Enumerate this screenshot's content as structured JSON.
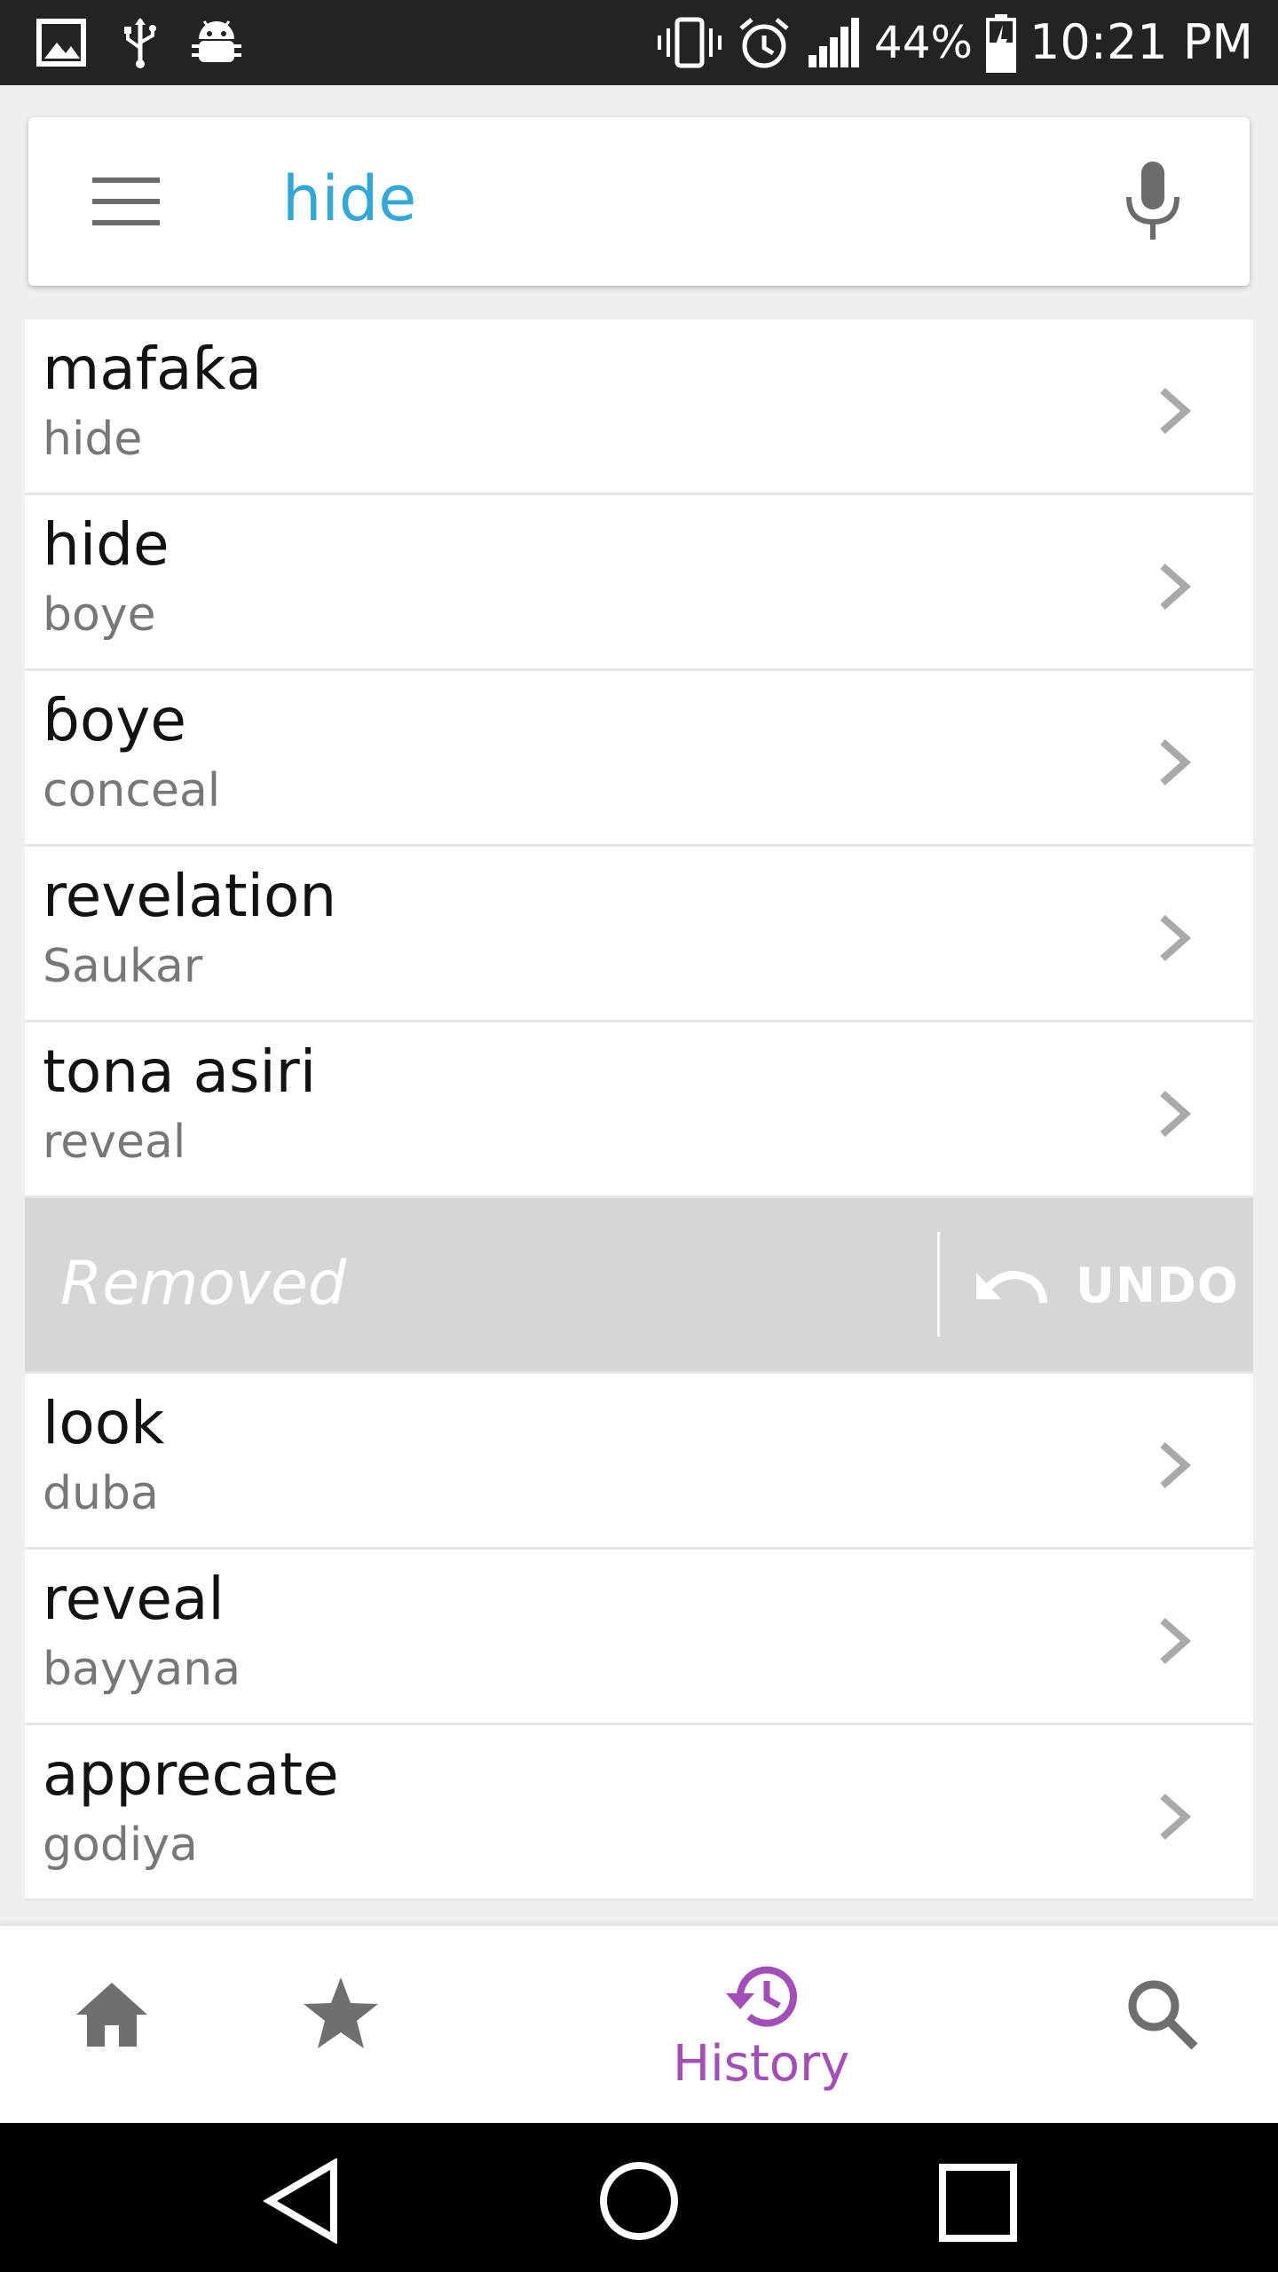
{
  "status_bar": {
    "battery_percent": "44%",
    "time": "10:21 PM",
    "icons_left": [
      "image-icon",
      "usb-icon",
      "android-debug-icon"
    ],
    "icons_right": [
      "vibrate-icon",
      "alarm-icon",
      "signal-icon",
      "battery-charging-icon"
    ]
  },
  "search": {
    "query": "hide",
    "menu_icon": "hamburger-menu-icon",
    "mic_icon": "microphone-icon"
  },
  "history_items": [
    {
      "title": "mafaƙa",
      "subtitle": "hide"
    },
    {
      "title": "hide",
      "subtitle": "boye"
    },
    {
      "title": "ɓoye",
      "subtitle": "conceal"
    },
    {
      "title": "revelation",
      "subtitle": "Saukar"
    },
    {
      "title": "tona asiri",
      "subtitle": "reveal"
    }
  ],
  "removed_snackbar": {
    "text": "Removed",
    "action_label": "UNDO"
  },
  "history_items_after": [
    {
      "title": "look",
      "subtitle": "duba"
    },
    {
      "title": "reveal",
      "subtitle": "bayyana"
    },
    {
      "title": "apprecate",
      "subtitle": "godiya"
    }
  ],
  "bottom_nav": {
    "home_icon": "home-icon",
    "favorites_icon": "star-icon",
    "history_label": "History",
    "history_icon": "history-icon",
    "search_icon": "search-icon",
    "active_color": "#a24db8",
    "inactive_color": "#6f6f6f"
  },
  "colors": {
    "search_text": "#33a7d7",
    "removed_bg": "#d6d6d6"
  }
}
